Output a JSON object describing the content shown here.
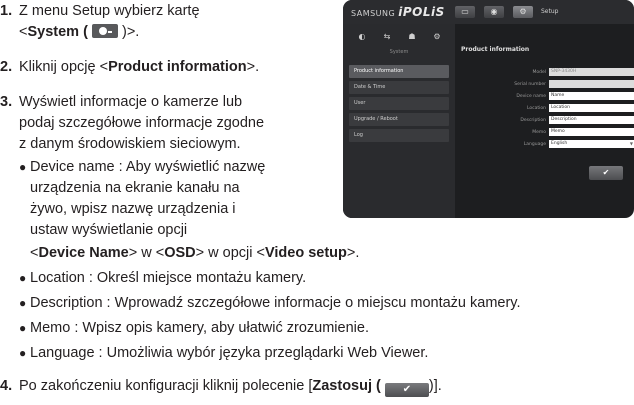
{
  "steps": {
    "s1": {
      "num": "1.",
      "l1": "Z menu Setup wybierz kartę",
      "l2_pre": "<",
      "l2_bold": "System (",
      "l2_post": ")>."
    },
    "s2": {
      "num": "2.",
      "pre": "Kliknij opcję <",
      "bold": "Product information",
      "post": ">."
    },
    "s3": {
      "num": "3.",
      "l1": "Wyświetl informacje o kamerze lub",
      "l2": "podaj szczegółowe informacje zgodne",
      "l3": "z danym środowiskiem sieciowym."
    },
    "device": {
      "l1": "Device name : Aby wyświetlić nazwę",
      "l2": "urządzenia na ekranie kanału na",
      "l3": "żywo, wpisz nazwę urządzenia i",
      "l4": "ustaw wyświetlanie opcji",
      "l5_a": "<",
      "l5_b": "Device Name",
      "l5_c": "> w <",
      "l5_d": "OSD",
      "l5_e": "> w opcji <",
      "l5_f": "Video setup",
      "l5_g": ">."
    },
    "bullets": [
      "Location : Określ miejsce montażu kamery.",
      "Description : Wprowadź szczegółowe informacje o miejscu montażu kamery.",
      "Memo : Wpisz opis kamery, aby ułatwić zrozumienie.",
      "Language : Umożliwia wybór języka przeglądarki Web Viewer."
    ],
    "s4": {
      "num": "4.",
      "pre": "Po zakończeniu konfiguracji kliknij polecenie [",
      "bold": "Zastosuj (",
      "post": ")]."
    },
    "apply_glyph": "✔"
  },
  "screenshot": {
    "brand": "SAMSUNG",
    "product": "iPOLiS",
    "top_icons": [
      "monitor-icon",
      "playback-icon",
      "gear-icon"
    ],
    "top_glyphs": [
      "▭",
      "◉",
      "⚙"
    ],
    "setup_label": "Setup",
    "side_icon_glyphs": [
      "◐",
      "⇆",
      "☗",
      "⚙"
    ],
    "side_section": "System",
    "menu": [
      "Product information",
      "Date & Time",
      "User",
      "Upgrade / Reboot",
      "Log"
    ],
    "panel_title": "Product information",
    "fields": [
      {
        "label": "Model",
        "value": "SNP-3430H"
      },
      {
        "label": "Serial number",
        "value": ""
      },
      {
        "label": "Device name",
        "value": "Name"
      },
      {
        "label": "Location",
        "value": "Location"
      },
      {
        "label": "Description",
        "value": "Description"
      },
      {
        "label": "Memo",
        "value": "Memo"
      },
      {
        "label": "Language",
        "value": "English"
      }
    ],
    "apply_glyph": "✔"
  }
}
